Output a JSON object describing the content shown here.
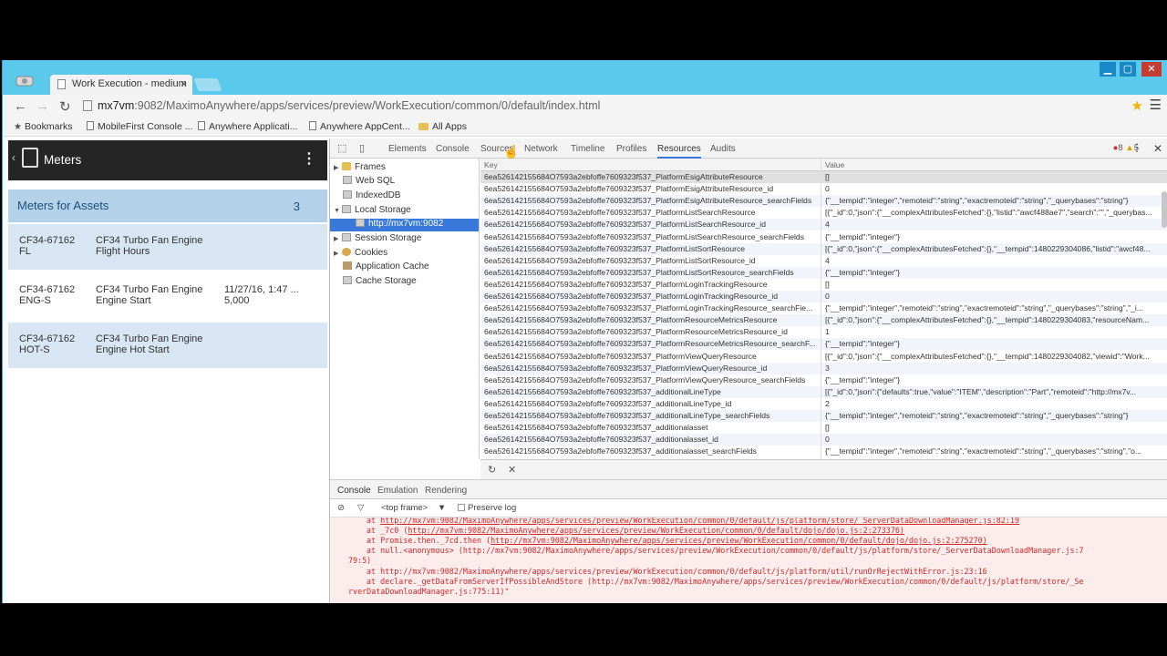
{
  "browser": {
    "tab_title": "Work Execution - medium",
    "tab_close": "×",
    "win_min": "▁",
    "win_max": "▢",
    "win_close": "✕",
    "back": "←",
    "forward": "→",
    "reload": "↻",
    "url_host": "mx7vm",
    "url_rest": ":9082/MaximoAnywhere/apps/services/preview/WorkExecution/common/0/default/index.html",
    "star": "★",
    "menu": "☰",
    "bookmarks": [
      {
        "label": "Bookmarks",
        "icon": "star-icon"
      },
      {
        "label": "MobileFirst Console ...",
        "icon": "page-icon"
      },
      {
        "label": "Anywhere Applicati...",
        "icon": "page-icon"
      },
      {
        "label": "Anywhere AppCent...",
        "icon": "page-icon"
      },
      {
        "label": "All Apps",
        "icon": "folder-icon"
      }
    ]
  },
  "app": {
    "back": "‹",
    "title": "Meters",
    "kebab": "⋮",
    "section_title": "Meters for Assets",
    "section_count": "3",
    "rows": [
      {
        "id": "CF34-67162\nFL",
        "desc": "CF34 Turbo Fan Engine\nFlight Hours",
        "extra": ""
      },
      {
        "id": "CF34-67162\nENG-S",
        "desc": "CF34 Turbo Fan Engine\nEngine Start",
        "extra": "11/27/16, 1:47 ...\n5,000"
      },
      {
        "id": "CF34-67162\nHOT-S",
        "desc": "CF34 Turbo Fan Engine\nEngine Hot Start",
        "extra": ""
      }
    ]
  },
  "devtools": {
    "tabs": [
      "Elements",
      "Console",
      "Sources",
      "Network",
      "Timeline",
      "Profiles",
      "Resources",
      "Audits"
    ],
    "active_tab": "Resources",
    "errors": "8",
    "warnings": "5",
    "error_glyph": "●",
    "warning_glyph": "▲",
    "close": "✕",
    "more": "⋮",
    "inspect_glyph": "⬚",
    "device_glyph": "▯",
    "tree": [
      {
        "label": "Frames",
        "arrow": "▶",
        "icon": "folder",
        "indent": 0
      },
      {
        "label": "Web SQL",
        "arrow": "",
        "icon": "db",
        "indent": 1
      },
      {
        "label": "IndexedDB",
        "arrow": "",
        "icon": "db",
        "indent": 1
      },
      {
        "label": "Local Storage",
        "arrow": "▼",
        "icon": "db",
        "indent": 0
      },
      {
        "label": "http://mx7vm:9082",
        "arrow": "",
        "icon": "db",
        "indent": 2,
        "selected": true
      },
      {
        "label": "Session Storage",
        "arrow": "▶",
        "icon": "db",
        "indent": 0
      },
      {
        "label": "Cookies",
        "arrow": "▶",
        "icon": "cookie",
        "indent": 0
      },
      {
        "label": "Application Cache",
        "arrow": "",
        "icon": "cache",
        "indent": 1
      },
      {
        "label": "Cache Storage",
        "arrow": "",
        "icon": "db",
        "indent": 1
      }
    ],
    "grid": {
      "key_header": "Key",
      "value_header": "Value",
      "rows": [
        {
          "k": "6ea526142155684O7593a2ebfoffe7609323f537_PlatformEsigAttributeResource",
          "v": "[]"
        },
        {
          "k": "6ea526142155684O7593a2ebfoffe7609323f537_PlatformEsigAttributeResource_id",
          "v": "0"
        },
        {
          "k": "6ea526142155684O7593a2ebfoffe7609323f537_PlatformEsigAttributeResource_searchFields",
          "v": "{\"__tempid\":\"integer\",\"remoteid\":\"string\",\"exactremoteid\":\"string\",\"_querybases\":\"string\"}"
        },
        {
          "k": "6ea526142155684O7593a2ebfoffe7609323f537_PlatformListSearchResource",
          "v": "[{\"_id\":0,\"json\":{\"__complexAttributesFetched\":{},\"listid\":\"awcf488ae7\",\"search\":\"\",\"_querybas..."
        },
        {
          "k": "6ea526142155684O7593a2ebfoffe7609323f537_PlatformListSearchResource_id",
          "v": "4"
        },
        {
          "k": "6ea526142155684O7593a2ebfoffe7609323f537_PlatformListSearchResource_searchFields",
          "v": "{\"__tempid\":\"integer\"}"
        },
        {
          "k": "6ea526142155684O7593a2ebfoffe7609323f537_PlatformListSortResource",
          "v": "[{\"_id\":0,\"json\":{\"__complexAttributesFetched\":{},\"__tempid\":1480229304086,\"listid\":\"awcf48..."
        },
        {
          "k": "6ea526142155684O7593a2ebfoffe7609323f537_PlatformListSortResource_id",
          "v": "4"
        },
        {
          "k": "6ea526142155684O7593a2ebfoffe7609323f537_PlatformListSortResource_searchFields",
          "v": "{\"__tempid\":\"integer\"}"
        },
        {
          "k": "6ea526142155684O7593a2ebfoffe7609323f537_PlatformLoginTrackingResource",
          "v": "[]"
        },
        {
          "k": "6ea526142155684O7593a2ebfoffe7609323f537_PlatformLoginTrackingResource_id",
          "v": "0"
        },
        {
          "k": "6ea526142155684O7593a2ebfoffe7609323f537_PlatformLoginTrackingResource_searchFie...",
          "v": "{\"__tempid\":\"integer\",\"remoteid\":\"string\",\"exactremoteid\":\"string\",\"_querybases\":\"string\",\"_i..."
        },
        {
          "k": "6ea526142155684O7593a2ebfoffe7609323f537_PlatformResourceMetricsResource",
          "v": "[{\"_id\":0,\"json\":{\"__complexAttributesFetched\":{},\"__tempid\":1480229304083,\"resourceNam..."
        },
        {
          "k": "6ea526142155684O7593a2ebfoffe7609323f537_PlatformResourceMetricsResource_id",
          "v": "1"
        },
        {
          "k": "6ea526142155684O7593a2ebfoffe7609323f537_PlatformResourceMetricsResource_searchF...",
          "v": "{\"__tempid\":\"integer\"}"
        },
        {
          "k": "6ea526142155684O7593a2ebfoffe7609323f537_PlatformViewQueryResource",
          "v": "[{\"_id\":0,\"json\":{\"__complexAttributesFetched\":{},\"__tempid\":1480229304082,\"viewid\":\"Work..."
        },
        {
          "k": "6ea526142155684O7593a2ebfoffe7609323f537_PlatformViewQueryResource_id",
          "v": "3"
        },
        {
          "k": "6ea526142155684O7593a2ebfoffe7609323f537_PlatformViewQueryResource_searchFields",
          "v": "{\"__tempid\":\"integer\"}"
        },
        {
          "k": "6ea526142155684O7593a2ebfoffe7609323f537_additionalLineType",
          "v": "[{\"_id\":0,\"json\":{\"defaults\":true,\"value\":\"ITEM\",\"description\":\"Part\",\"remoteid\":\"http://mx7v..."
        },
        {
          "k": "6ea526142155684O7593a2ebfoffe7609323f537_additionalLineType_id",
          "v": "2"
        },
        {
          "k": "6ea526142155684O7593a2ebfoffe7609323f537_additionalLineType_searchFields",
          "v": "{\"__tempid\":\"integer\",\"remoteid\":\"string\",\"exactremoteid\":\"string\",\"_querybases\":\"string\"}"
        },
        {
          "k": "6ea526142155684O7593a2ebfoffe7609323f537_additionalasset",
          "v": "[]"
        },
        {
          "k": "6ea526142155684O7593a2ebfoffe7609323f537_additionalasset_id",
          "v": "0"
        },
        {
          "k": "6ea526142155684O7593a2ebfoffe7609323f537_additionalasset_searchFields",
          "v": "{\"__tempid\":\"integer\",\"remoteid\":\"string\",\"exactremoteid\":\"string\",\"_querybases\":\"string\",\"o..."
        }
      ],
      "refresh": "↻",
      "delete": "✕"
    },
    "drawer_tabs": [
      "Console",
      "Emulation",
      "Rendering"
    ],
    "console": {
      "clear_glyph": "⊘",
      "filter_glyph": "▽",
      "frame": "<top frame>",
      "frame_arrow": "▼",
      "preserve_log": "Preserve log",
      "lines": [
        {
          "pre": "at ",
          "text": "http://mx7vm:9082/MaximoAnywhere/apps/services/preview/WorkExecution/common/0/default/js/platform/store/_ServerDataDownloadManager.js:82:19",
          "link": true,
          "indent": 20
        },
        {
          "pre": "at _7c0 (",
          "text": "http://mx7vm:9082/MaximoAnywhere/apps/services/preview/WorkExecution/common/0/default/dojo/dojo.js:2:273376)",
          "link": true,
          "indent": 20
        },
        {
          "pre": "at Promise.then._7cd.then (",
          "text": "http://mx7vm:9082/MaximoAnywhere/apps/services/preview/WorkExecution/common/0/default/dojo/dojo.js:2:275270)",
          "link": true,
          "indent": 20
        },
        {
          "pre": "at null.<anonymous> ",
          "text": "(http://mx7vm:9082/MaximoAnywhere/apps/services/preview/WorkExecution/common/0/default/js/platform/store/_ServerDataDownloadManager.js:7",
          "link": false,
          "indent": 20
        },
        {
          "pre": "",
          "text": "79:5)",
          "link": false,
          "indent": 0
        },
        {
          "pre": "at ",
          "text": "http://mx7vm:9082/MaximoAnywhere/apps/services/preview/WorkExecution/common/0/default/js/platform/util/runOrRejectWithError.js:23:16",
          "link": false,
          "indent": 20
        },
        {
          "pre": "at declare._getDataFromServerIfPossibleAndStore ",
          "text": "(http://mx7vm:9082/MaximoAnywhere/apps/services/preview/WorkExecution/common/0/default/js/platform/store/_Se",
          "link": false,
          "indent": 20
        },
        {
          "pre": "",
          "text": "rverDataDownloadManager.js:775:11)\"",
          "link": false,
          "indent": 0
        }
      ]
    }
  }
}
